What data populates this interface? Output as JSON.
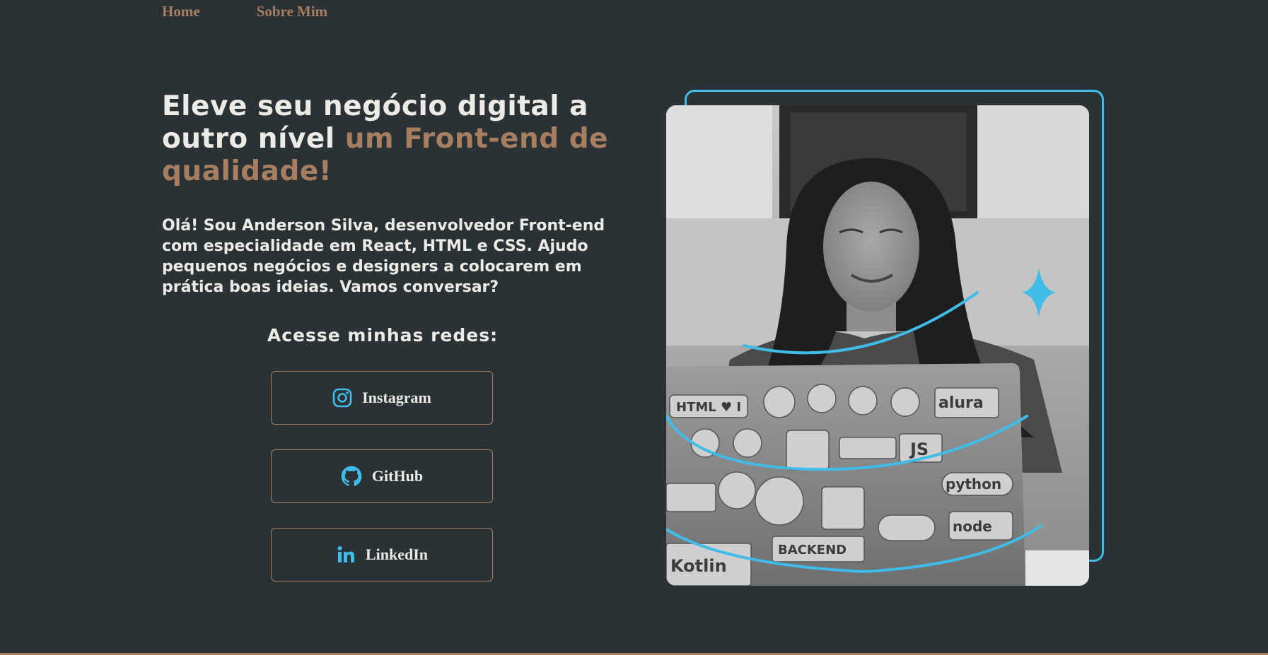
{
  "nav": {
    "items": [
      "Home",
      "Sobre Mim"
    ]
  },
  "hero": {
    "headline_main": "Eleve seu negócio digital a outro nível ",
    "headline_accent": "um Front-end de qualidade!",
    "intro": "Olá! Sou Anderson Silva, desenvolvedor Front-end com especialidade em React, HTML e CSS. Ajudo pequenos negócios e designers a colocarem em prática boas ideias. Vamos conversar?"
  },
  "social": {
    "title": "Acesse minhas redes:",
    "links": [
      {
        "label": "Instagram",
        "icon": "instagram-icon"
      },
      {
        "label": "GitHub",
        "icon": "github-icon"
      },
      {
        "label": "LinkedIn",
        "icon": "linkedin-icon"
      }
    ]
  },
  "laptop_stickers": [
    "HTML ♥ I",
    "alura",
    "JS",
    "python",
    "BACKEND",
    "Kotlin",
    "node"
  ],
  "colors": {
    "background": "#2b3236",
    "text": "#ecebe5",
    "accent_brown": "#a87e61",
    "accent_blue": "#3fbce8"
  }
}
